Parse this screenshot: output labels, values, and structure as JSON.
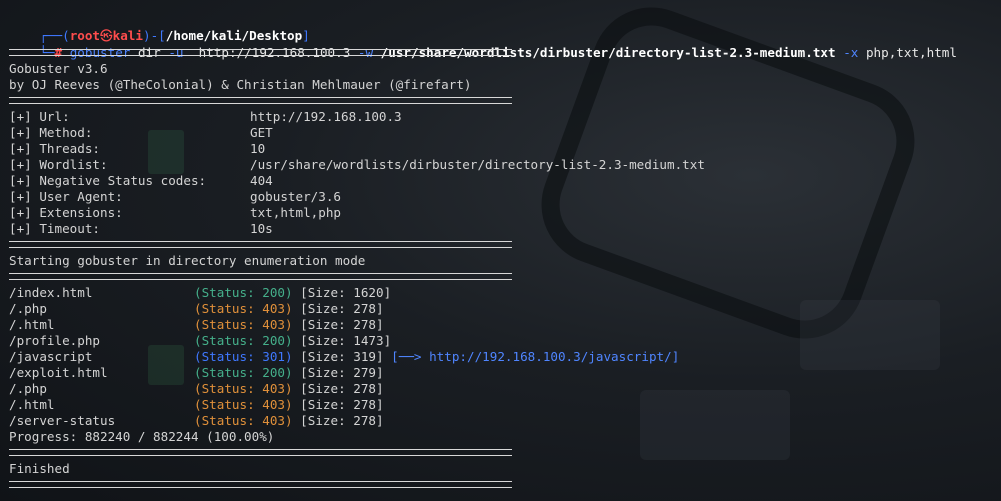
{
  "prompt": {
    "corner_top": "┌──",
    "user": "root",
    "skull": "㉿",
    "host": "kali",
    "dash": "-[",
    "path": "/home/kali/Desktop",
    "close": "]",
    "corner_bottom": "└─",
    "hash": "#",
    "command": "gobuster",
    "arg1": "dir",
    "flag_u": "-u",
    "url": "http://192.168.100.3",
    "flag_w": "-w",
    "wordlist": "/usr/share/wordlists/dirbuster/directory-list-2.3-medium.txt",
    "flag_x": "-x",
    "extensions": "php,txt,html"
  },
  "banner": {
    "version": "Gobuster v3.6",
    "authors": "by OJ Reeves (@TheColonial) & Christian Mehlmauer (@firefart)"
  },
  "config": [
    {
      "key": "[+] Url:",
      "value": "http://192.168.100.3"
    },
    {
      "key": "[+] Method:",
      "value": "GET"
    },
    {
      "key": "[+] Threads:",
      "value": "10"
    },
    {
      "key": "[+] Wordlist:",
      "value": "/usr/share/wordlists/dirbuster/directory-list-2.3-medium.txt"
    },
    {
      "key": "[+] Negative Status codes:",
      "value": "404"
    },
    {
      "key": "[+] User Agent:",
      "value": "gobuster/3.6"
    },
    {
      "key": "[+] Extensions:",
      "value": "txt,html,php"
    },
    {
      "key": "[+] Timeout:",
      "value": "10s"
    }
  ],
  "mode_message": "Starting gobuster in directory enumeration mode",
  "results": [
    {
      "path": "/index.html",
      "status": "(Status: 200)",
      "size": "[Size: 1620]",
      "redirect": ""
    },
    {
      "path": "/.php",
      "status": "(Status: 403)",
      "size": "[Size: 278]",
      "redirect": ""
    },
    {
      "path": "/.html",
      "status": "(Status: 403)",
      "size": "[Size: 278]",
      "redirect": ""
    },
    {
      "path": "/profile.php",
      "status": "(Status: 200)",
      "size": "[Size: 1473]",
      "redirect": ""
    },
    {
      "path": "/javascript",
      "status": "(Status: 301)",
      "size": "[Size: 319]",
      "redirect": "[──> http://192.168.100.3/javascript/]"
    },
    {
      "path": "/exploit.html",
      "status": "(Status: 200)",
      "size": "[Size: 279]",
      "redirect": ""
    },
    {
      "path": "/.php",
      "status": "(Status: 403)",
      "size": "[Size: 278]",
      "redirect": ""
    },
    {
      "path": "/.html",
      "status": "(Status: 403)",
      "size": "[Size: 278]",
      "redirect": ""
    },
    {
      "path": "/server-status",
      "status": "(Status: 403)",
      "size": "[Size: 278]",
      "redirect": ""
    }
  ],
  "progress": "Progress: 882240 / 882244 (100.00%)",
  "finished": "Finished",
  "colors": {
    "status_200": "#45b08b",
    "status_301": "#3f78ff",
    "status_403": "#e0903a",
    "prompt_user": "#ff4d4d",
    "prompt_frame": "#3f78ff"
  }
}
